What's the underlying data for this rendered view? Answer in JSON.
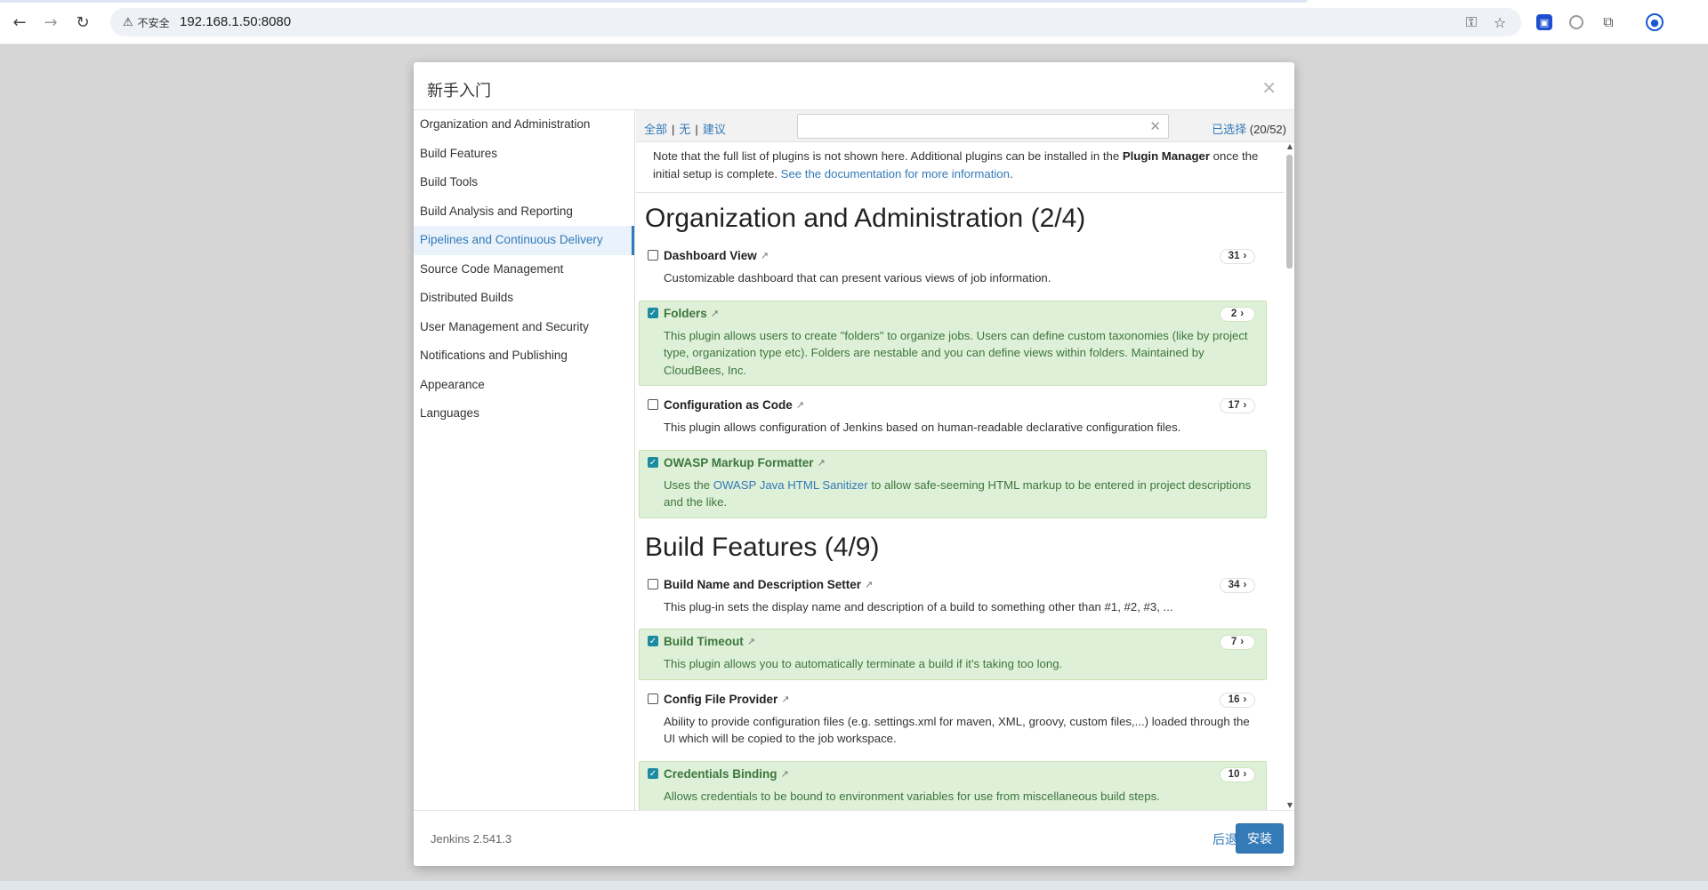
{
  "browser": {
    "security_label": "不安全",
    "url": "192.168.1.50:8080"
  },
  "dialog": {
    "title": "新手入门",
    "close_glyph": "×"
  },
  "sidebar": {
    "items": [
      {
        "label": "Organization and Administration"
      },
      {
        "label": "Build Features"
      },
      {
        "label": "Build Tools"
      },
      {
        "label": "Build Analysis and Reporting"
      },
      {
        "label": "Pipelines and Continuous Delivery",
        "active": true
      },
      {
        "label": "Source Code Management"
      },
      {
        "label": "Distributed Builds"
      },
      {
        "label": "User Management and Security"
      },
      {
        "label": "Notifications and Publishing"
      },
      {
        "label": "Appearance"
      },
      {
        "label": "Languages"
      }
    ]
  },
  "toolbar": {
    "all": "全部",
    "none": "无",
    "suggested": "建议",
    "separator": "|",
    "search_value": "",
    "selected_label": "已选择",
    "selected_count": "(20/52)"
  },
  "note": {
    "text_before": "Note that the full list of plugins is not shown here. Additional plugins can be installed in the ",
    "plugin_manager": "Plugin Manager",
    "text_after": " once the initial setup is complete. ",
    "link": "See the documentation for more information",
    "end": "."
  },
  "categories": [
    {
      "title": "Organization and Administration (2/4)",
      "plugins": [
        {
          "name": "Dashboard View",
          "deps": "31",
          "selected": false,
          "desc": "Customizable dashboard that can present various views of job information."
        },
        {
          "name": "Folders",
          "deps": "2",
          "selected": true,
          "desc": "This plugin allows users to create \"folders\" to organize jobs. Users can define custom taxonomies (like by project type, organization type etc). Folders are nestable and you can define views within folders. Maintained by CloudBees, Inc."
        },
        {
          "name": "Configuration as Code",
          "deps": "17",
          "selected": false,
          "desc": "This plugin allows configuration of Jenkins based on human-readable declarative configuration files."
        },
        {
          "name": "OWASP Markup Formatter",
          "deps": "",
          "selected": true,
          "desc_before": "Uses the ",
          "desc_link": "OWASP Java HTML Sanitizer",
          "desc_after": " to allow safe-seeming HTML markup to be entered in project descriptions and the like."
        }
      ]
    },
    {
      "title": "Build Features (4/9)",
      "plugins": [
        {
          "name": "Build Name and Description Setter",
          "deps": "34",
          "selected": false,
          "desc": "This plug-in sets the display name and description of a build to something other than #1, #2, #3, ..."
        },
        {
          "name": "Build Timeout",
          "deps": "7",
          "selected": true,
          "desc": "This plugin allows you to automatically terminate a build if it's taking too long."
        },
        {
          "name": "Config File Provider",
          "deps": "16",
          "selected": false,
          "desc": "Ability to provide configuration files (e.g. settings.xml for maven, XML, groovy, custom files,...) loaded through the UI which will be copied to the job workspace."
        },
        {
          "name": "Credentials Binding",
          "deps": "10",
          "selected": true,
          "desc": "Allows credentials to be bound to environment variables for use from miscellaneous build steps."
        }
      ]
    }
  ],
  "badge_arrow": "›",
  "footer": {
    "version": "Jenkins 2.541.3",
    "back": "后退",
    "install": "安装"
  },
  "icons": {
    "back": "arrow-left-icon",
    "forward": "arrow-right-icon",
    "reload": "reload-icon",
    "warning": "warning-triangle-icon",
    "key": "key-icon",
    "star": "star-icon",
    "extensions": "puzzle-icon",
    "profile": "profile-icon",
    "external": "external-link-icon"
  },
  "colors": {
    "accent": "#337ab7",
    "selected_bg": "#dff0d8",
    "selected_text": "#3c763d",
    "checkbox_checked": "#1c8aa0"
  }
}
